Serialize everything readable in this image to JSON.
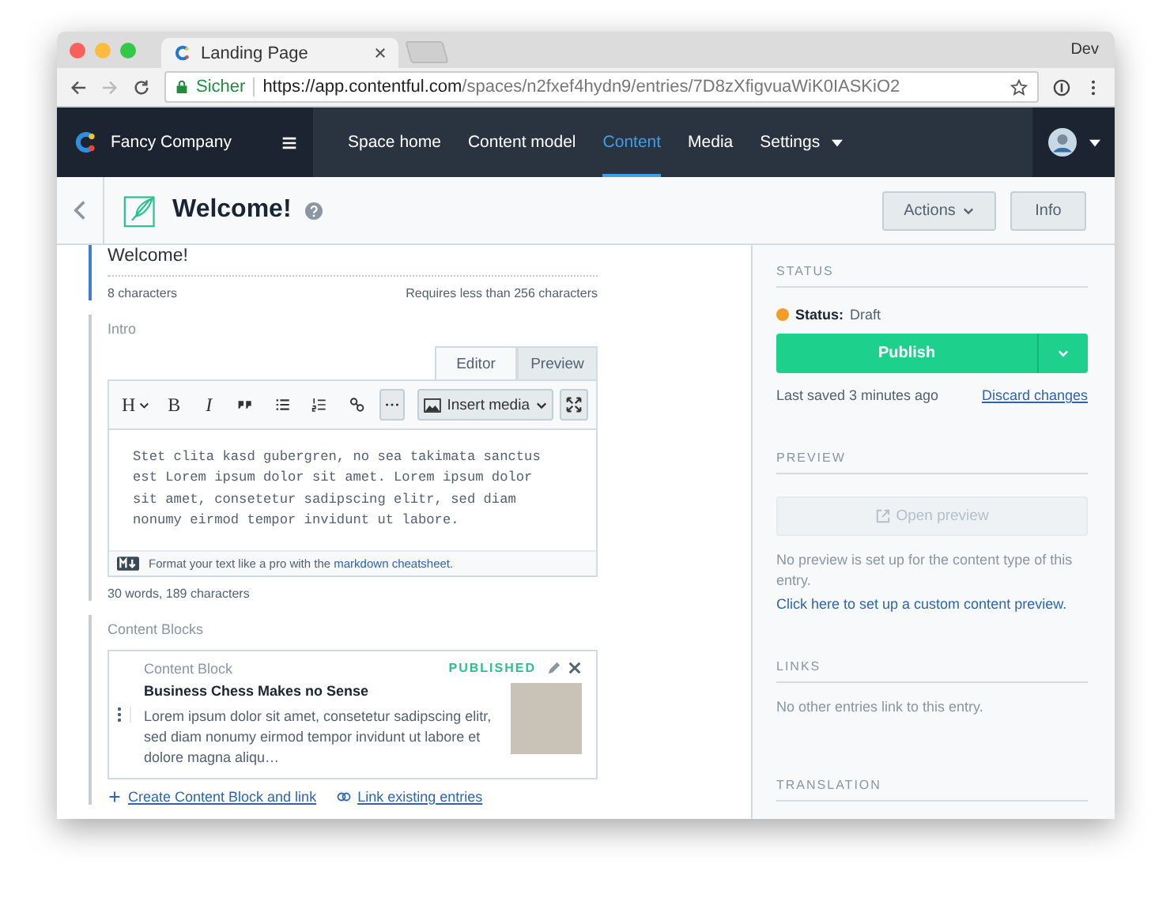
{
  "browser": {
    "tab_title": "Landing Page",
    "profile": "Dev",
    "secure_label": "Sicher",
    "url_host": "https://app.contentful.com",
    "url_path": "/spaces/n2fxef4hydn9/entries/7D8zXfigvuaWiK0IASKiO2"
  },
  "nav": {
    "space_name": "Fancy Company",
    "items": [
      {
        "label": "Space home",
        "selected": false,
        "dropdown": false
      },
      {
        "label": "Content model",
        "selected": false,
        "dropdown": false
      },
      {
        "label": "Content",
        "selected": true,
        "dropdown": false
      },
      {
        "label": "Media",
        "selected": false,
        "dropdown": false
      },
      {
        "label": "Settings",
        "selected": false,
        "dropdown": true
      }
    ]
  },
  "entry_header": {
    "title": "Welcome!",
    "actions": "Actions",
    "info": "Info"
  },
  "title_field": {
    "value": "Welcome!",
    "count": "8 characters",
    "limit": "Requires less than 256 characters"
  },
  "intro_field": {
    "label": "Intro",
    "tabs": [
      {
        "label": "Editor",
        "selected": true
      },
      {
        "label": "Preview",
        "selected": false
      }
    ],
    "toolbar": [
      {
        "kind": "heading",
        "label": "H"
      },
      {
        "kind": "bold",
        "label": "B"
      },
      {
        "kind": "italic",
        "label": "I"
      },
      {
        "kind": "quote"
      },
      {
        "kind": "list"
      },
      {
        "kind": "numbered"
      },
      {
        "kind": "link"
      },
      {
        "kind": "more"
      }
    ],
    "insert_media": "Insert media",
    "text": "Stet clita kasd gubergren, no sea takimata sanctus est Lorem ipsum dolor sit amet. Lorem ipsum dolor sit amet, consetetur sadipscing elitr, sed diam nonumy eirmod tempor invidunt ut labore.",
    "hint": "Format your text like a pro with the",
    "hint_link": "markdown cheatsheet.",
    "count": "30 words, 189 characters"
  },
  "content_blocks": {
    "label": "Content Blocks",
    "entries": [
      {
        "type": "Content Block",
        "status": "PUBLISHED",
        "title": "Business Chess Makes no Sense",
        "excerpt": "Lorem ipsum dolor sit amet, consetetur sadipscing elitr, sed diam nonumy eirmod tempor invidunt ut labore et dolore magna aliqu…"
      }
    ],
    "create_link": "Create Content Block and link",
    "link_existing": "Link existing entries"
  },
  "sidebar": {
    "status": {
      "heading": "STATUS",
      "label": "Status:",
      "value": "Draft",
      "color": "#f39c2a",
      "publish": "Publish",
      "last_saved": "Last saved 3 minutes ago",
      "discard": "Discard changes"
    },
    "preview": {
      "heading": "PREVIEW",
      "button": "Open preview",
      "disabled": true,
      "note": "No preview is set up for the content type of this entry.",
      "setup_link": "Click here to set up a custom content preview."
    },
    "links": {
      "heading": "LINKS",
      "note": "No other entries link to this entry."
    },
    "translation": {
      "heading": "TRANSLATION"
    }
  }
}
